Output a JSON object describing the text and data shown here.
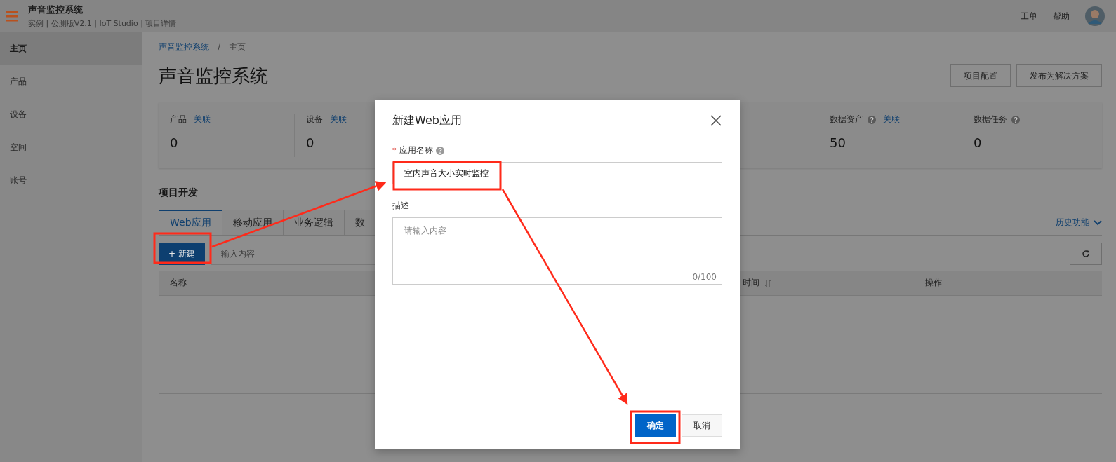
{
  "header": {
    "title": "声音监控系统",
    "subtitle": "实例 | 公测版V2.1 | IoT Studio | 项目详情",
    "links": [
      "工单",
      "帮助"
    ]
  },
  "sidebar": {
    "items": [
      {
        "label": "主页",
        "selected": true
      },
      {
        "label": "产品",
        "selected": false
      },
      {
        "label": "设备",
        "selected": false
      },
      {
        "label": "空间",
        "selected": false
      },
      {
        "label": "账号",
        "selected": false
      }
    ]
  },
  "breadcrumb": {
    "link": "声音监控系统",
    "separator": "/",
    "current": "主页"
  },
  "page_title": "声音监控系统",
  "actions": [
    "项目配置",
    "发布为解决方案"
  ],
  "stats": [
    {
      "label": "产品",
      "help": false,
      "link": "关联",
      "value": "0"
    },
    {
      "label": "设备",
      "help": false,
      "link": "关联",
      "value": "0"
    },
    {
      "label": "数据资产",
      "help": true,
      "link": "关联",
      "value": "50"
    },
    {
      "label": "数据任务",
      "help": true,
      "value": "0"
    }
  ],
  "section_title": "项目开发",
  "tabs": [
    {
      "label": "Web应用",
      "selected": true
    },
    {
      "label": "移动应用",
      "selected": false
    },
    {
      "label": "业务逻辑",
      "selected": false
    },
    {
      "label": "数",
      "selected": false
    }
  ],
  "history_link": "历史功能",
  "toolbar": {
    "new_button": "+ 新建",
    "search": {
      "placeholder": "输入内容"
    }
  },
  "table": {
    "columns": [
      "名称",
      "时间",
      "操作"
    ]
  },
  "dialog": {
    "title": "新建Web应用",
    "required_mark": "*",
    "name_label": "应用名称",
    "name_value": "室内声音大小实时监控",
    "desc_label": "描述",
    "desc_placeholder": "请输入内容",
    "counter": "0/100",
    "buttons": [
      {
        "label": "确定",
        "kind": "primary"
      },
      {
        "label": "取消",
        "kind": "secondary"
      }
    ]
  }
}
